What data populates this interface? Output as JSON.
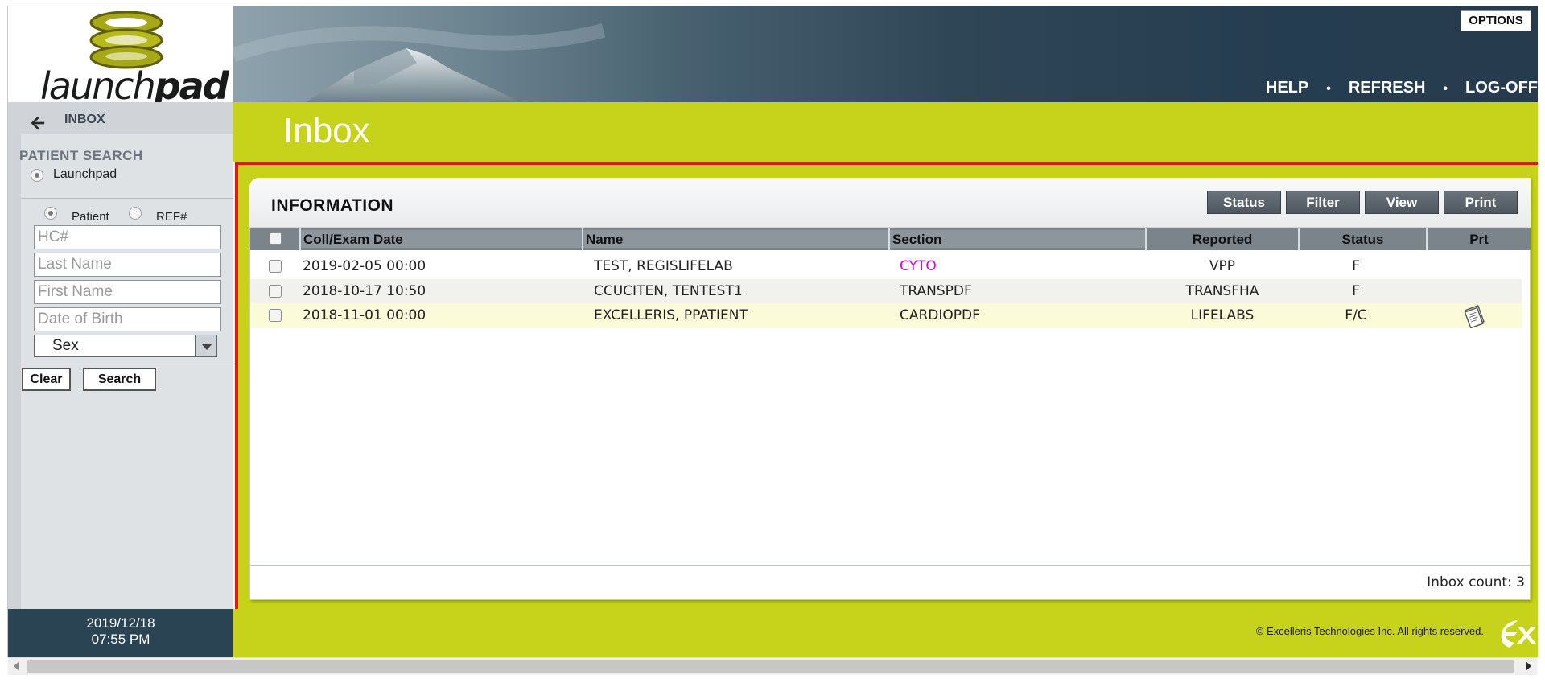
{
  "logo": {
    "text_light": "launch",
    "text_bold": "pad"
  },
  "header": {
    "options_label": "OPTIONS",
    "links": [
      "HELP",
      "REFRESH",
      "LOG-OFF"
    ],
    "separator": "•"
  },
  "sidebar": {
    "back_label": "INBOX",
    "patient_search_title": "PATIENT SEARCH",
    "scope_option": "Launchpad",
    "id_options": [
      "Patient",
      "REF#"
    ],
    "fields": {
      "hc_placeholder": "HC#",
      "last_name_placeholder": "Last Name",
      "first_name_placeholder": "First Name",
      "dob_placeholder": "Date of Birth",
      "sex_value": "Sex"
    },
    "clear_label": "Clear",
    "search_label": "Search",
    "date": "2019/12/18",
    "time": "07:55 PM"
  },
  "main": {
    "page_title": "Inbox",
    "panel_title": "INFORMATION",
    "toolbar": [
      "Status",
      "Filter",
      "View",
      "Print"
    ],
    "columns": [
      "Coll/Exam Date",
      "Name",
      "Section",
      "Reported",
      "Status",
      "Prt"
    ],
    "rows": [
      {
        "date": "2019-02-05 00:00",
        "name": "TEST, REGISLIFELAB",
        "section": "CYTO",
        "section_color": "#e000e0",
        "reported": "VPP",
        "status": "F",
        "prt": ""
      },
      {
        "date": "2018-10-17 10:50",
        "name": "CCUCITEN, TENTEST1",
        "section": "TRANSPDF",
        "section_color": "#222222",
        "reported": "TRANSFHA",
        "status": "F",
        "prt": ""
      },
      {
        "date": "2018-11-01 00:00",
        "name": "EXCELLERIS, PPATIENT",
        "section": "CARDIOPDF",
        "section_color": "#222222",
        "reported": "LIFELABS",
        "status": "F/C",
        "prt": "printed-report-icon"
      }
    ],
    "inbox_count": "Inbox count: 3"
  },
  "footer": {
    "copyright": "© Excelleris Technologies Inc. All rights reserved."
  },
  "colors": {
    "brand_green": "#c7d31b",
    "accent_red": "#e8141b",
    "nav_dark": "#2a4454",
    "toolbar_btn": "#5b646c"
  }
}
